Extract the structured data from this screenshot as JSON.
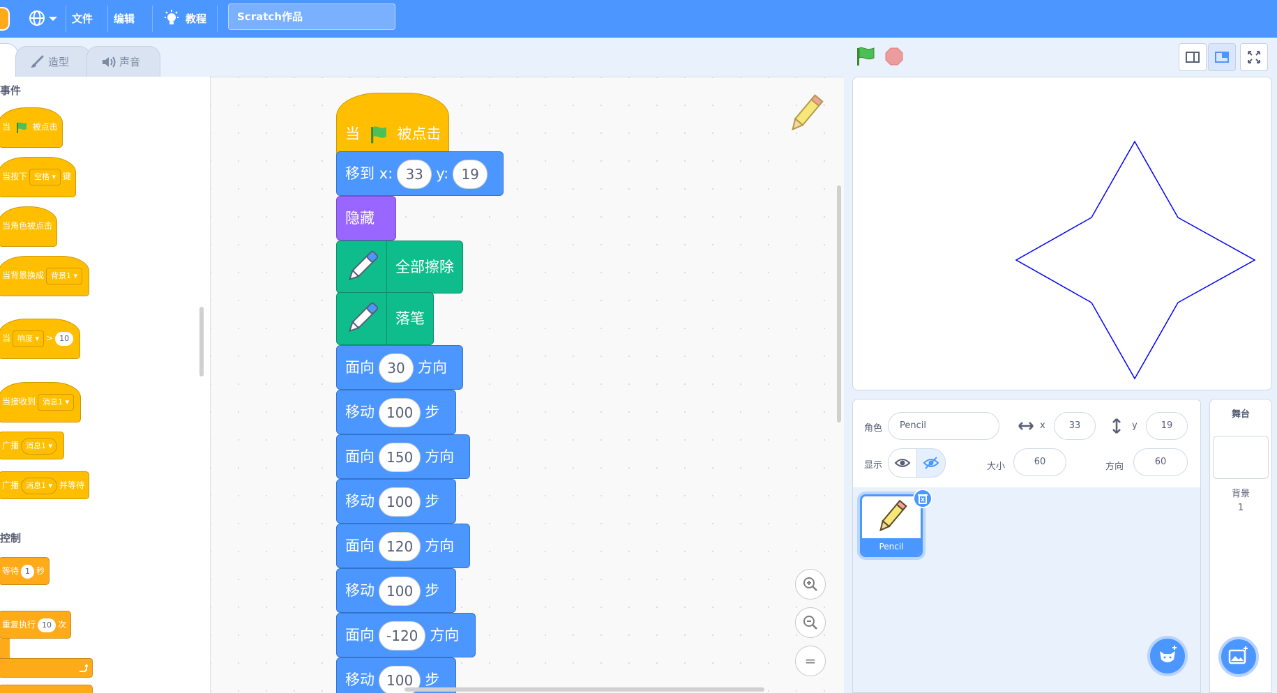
{
  "menubar": {
    "file": "文件",
    "edit": "编辑",
    "tutorials": "教程",
    "project_title": "Scratch作品"
  },
  "tabs": {
    "costumes": "造型",
    "sounds": "声音"
  },
  "palette": {
    "events_label": "事件",
    "control_label": "控制",
    "when_flag_pre": "当",
    "when_flag_post": "被点击",
    "when_key_pre": "当按下",
    "when_key_value": "空格",
    "when_key_post": "键",
    "when_sprite_clicked": "当角色被点击",
    "when_backdrop_pre": "当背景换成",
    "when_backdrop_value": "背景1",
    "when_loudness_pre": "当",
    "when_loudness_value": "响度",
    "when_loudness_op": ">",
    "when_loudness_num": "10",
    "when_receive_pre": "当接收到",
    "when_receive_value": "消息1",
    "broadcast_pre": "广播",
    "broadcast_value": "消息1",
    "broadcast_wait_pre": "广播",
    "broadcast_wait_value": "消息1",
    "broadcast_wait_post": "并等待",
    "wait_pre": "等待",
    "wait_value": "1",
    "wait_post": "秒",
    "repeat_pre": "重复执行",
    "repeat_value": "10",
    "repeat_post": "次"
  },
  "script": {
    "hat_pre": "当",
    "hat_post": "被点击",
    "goto_label": "移到 x:",
    "goto_x": "33",
    "goto_y_label": "y:",
    "goto_y": "19",
    "hide": "隐藏",
    "clear": "全部擦除",
    "pen_down": "落笔",
    "point_label": "面向",
    "direction_suffix": "方向",
    "move_label": "移动",
    "steps_suffix": "步",
    "dir1": "30",
    "move1": "100",
    "dir2": "150",
    "move2": "100",
    "dir3": "120",
    "move3": "100",
    "dir4": "-120",
    "move4": "100"
  },
  "zoom": {
    "reset_symbol": "="
  },
  "sprite_info": {
    "sprite_label": "角色",
    "sprite_name": "Pencil",
    "x_label": "x",
    "x_value": "33",
    "y_label": "y",
    "y_value": "19",
    "show_label": "显示",
    "size_label": "大小",
    "size_value": "60",
    "direction_label": "方向",
    "direction_value": "60"
  },
  "sprite_list": {
    "items": [
      {
        "name": "Pencil"
      }
    ]
  },
  "stage_pane": {
    "title": "舞台",
    "backdrops_label": "背景",
    "backdrops_count": "1"
  },
  "colors": {
    "menubar": "#4c97ff",
    "motion": "#4c97ff",
    "looks": "#9966ff",
    "pen": "#0fbd8c",
    "events": "#ffbf00",
    "control": "#ffab19",
    "star_stroke": "#0000ff"
  }
}
